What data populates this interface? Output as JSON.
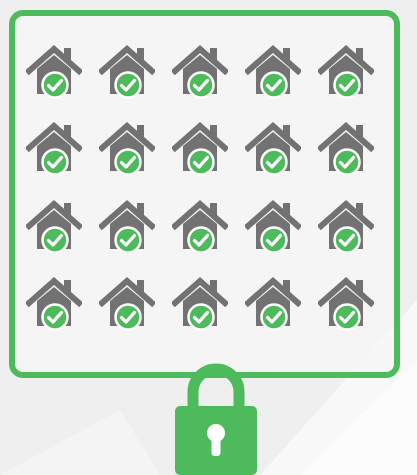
{
  "colors": {
    "accent": "#4dba5b",
    "house": "#727272",
    "background": "#efefef",
    "check": "#ffffff"
  },
  "icons": {
    "tile": "house-check-icon",
    "security": "padlock-icon"
  },
  "grid": {
    "rows": 4,
    "columns": 5,
    "tile_count": 20,
    "verified_count": 20
  }
}
